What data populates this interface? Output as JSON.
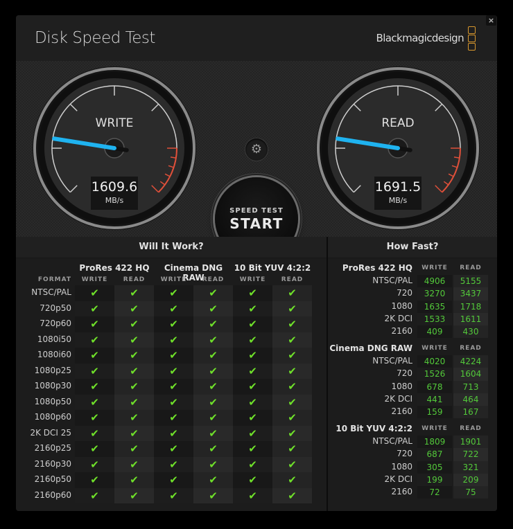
{
  "window": {
    "title": "Disk Speed Test",
    "brand": "Blackmagicdesign",
    "close_label": "×"
  },
  "icons": {
    "close": "close-icon",
    "settings": "gear-icon",
    "brand_logo": "blackmagic-logo-icon",
    "check": "checkmark-icon"
  },
  "colors": {
    "needle": "#1fb3f0",
    "redline": "#e0503a",
    "check": "#6fe02a",
    "speed_value": "#53c93a",
    "brand_accent": "#d9982d"
  },
  "gauges": {
    "write": {
      "label": "WRITE",
      "value": "1609.6",
      "unit": "MB/s",
      "needle_fraction": 0.2
    },
    "read": {
      "label": "READ",
      "value": "1691.5",
      "unit": "MB/s",
      "needle_fraction": 0.2
    }
  },
  "controls": {
    "settings_glyph": "⚙",
    "start_small": "SPEED TEST",
    "start_big": "START"
  },
  "will_it_work": {
    "title": "Will It Work?",
    "format_header": "FORMAT",
    "codecs": [
      "ProRes 422 HQ",
      "Cinema DNG RAW",
      "10 Bit YUV 4:2:2"
    ],
    "write_label": "WRITE",
    "read_label": "READ",
    "check_glyph": "✔",
    "formats": [
      "NTSC/PAL",
      "720p50",
      "720p60",
      "1080i50",
      "1080i60",
      "1080p25",
      "1080p30",
      "1080p50",
      "1080p60",
      "2K DCI 25",
      "2160p25",
      "2160p30",
      "2160p50",
      "2160p60"
    ],
    "results": [
      [
        true,
        true,
        true,
        true,
        true,
        true
      ],
      [
        true,
        true,
        true,
        true,
        true,
        true
      ],
      [
        true,
        true,
        true,
        true,
        true,
        true
      ],
      [
        true,
        true,
        true,
        true,
        true,
        true
      ],
      [
        true,
        true,
        true,
        true,
        true,
        true
      ],
      [
        true,
        true,
        true,
        true,
        true,
        true
      ],
      [
        true,
        true,
        true,
        true,
        true,
        true
      ],
      [
        true,
        true,
        true,
        true,
        true,
        true
      ],
      [
        true,
        true,
        true,
        true,
        true,
        true
      ],
      [
        true,
        true,
        true,
        true,
        true,
        true
      ],
      [
        true,
        true,
        true,
        true,
        true,
        true
      ],
      [
        true,
        true,
        true,
        true,
        true,
        true
      ],
      [
        true,
        true,
        true,
        true,
        true,
        true
      ],
      [
        true,
        true,
        true,
        true,
        true,
        true
      ]
    ]
  },
  "how_fast": {
    "title": "How Fast?",
    "write_label": "WRITE",
    "read_label": "READ",
    "groups": [
      {
        "codec": "ProRes 422 HQ",
        "rows": [
          {
            "format": "NTSC/PAL",
            "write": "4906",
            "read": "5155"
          },
          {
            "format": "720",
            "write": "3270",
            "read": "3437"
          },
          {
            "format": "1080",
            "write": "1635",
            "read": "1718"
          },
          {
            "format": "2K DCI",
            "write": "1533",
            "read": "1611"
          },
          {
            "format": "2160",
            "write": "409",
            "read": "430"
          }
        ]
      },
      {
        "codec": "Cinema DNG RAW",
        "rows": [
          {
            "format": "NTSC/PAL",
            "write": "4020",
            "read": "4224"
          },
          {
            "format": "720",
            "write": "1526",
            "read": "1604"
          },
          {
            "format": "1080",
            "write": "678",
            "read": "713"
          },
          {
            "format": "2K DCI",
            "write": "441",
            "read": "464"
          },
          {
            "format": "2160",
            "write": "159",
            "read": "167"
          }
        ]
      },
      {
        "codec": "10 Bit YUV 4:2:2",
        "rows": [
          {
            "format": "NTSC/PAL",
            "write": "1809",
            "read": "1901"
          },
          {
            "format": "720",
            "write": "687",
            "read": "722"
          },
          {
            "format": "1080",
            "write": "305",
            "read": "321"
          },
          {
            "format": "2K DCI",
            "write": "199",
            "read": "209"
          },
          {
            "format": "2160",
            "write": "72",
            "read": "75"
          }
        ]
      }
    ]
  }
}
